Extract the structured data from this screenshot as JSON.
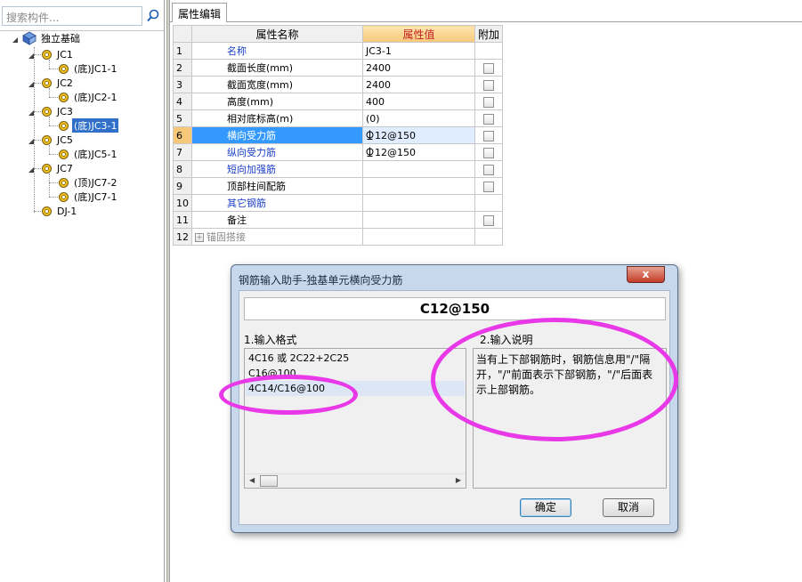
{
  "search": {
    "placeholder": "搜索构件..."
  },
  "tree": {
    "root": "独立基础",
    "nodes": [
      {
        "label": "JC1",
        "children": [
          "(底)JC1-1"
        ]
      },
      {
        "label": "JC2",
        "children": [
          "(底)JC2-1"
        ]
      },
      {
        "label": "JC3",
        "children": [
          "(底)JC3-1"
        ],
        "selected_child": "(底)JC3-1"
      },
      {
        "label": "JC5",
        "children": [
          "(底)JC5-1"
        ]
      },
      {
        "label": "JC7",
        "children": [
          "(顶)JC7-2",
          "(底)JC7-1"
        ]
      }
    ],
    "last": "DJ-1"
  },
  "tab": {
    "label": "属性编辑"
  },
  "grid": {
    "headers": {
      "name": "属性名称",
      "value": "属性值",
      "extra": "附加"
    },
    "rows": [
      {
        "n": "1",
        "name": "名称",
        "value": "JC3-1",
        "style": "blue",
        "check": false
      },
      {
        "n": "2",
        "name": "截面长度(mm)",
        "value": "2400",
        "style": "normal",
        "check": true
      },
      {
        "n": "3",
        "name": "截面宽度(mm)",
        "value": "2400",
        "style": "normal",
        "check": true
      },
      {
        "n": "4",
        "name": "高度(mm)",
        "value": "400",
        "style": "normal",
        "check": true
      },
      {
        "n": "5",
        "name": "相对底标高(m)",
        "value": "(0)",
        "style": "normal",
        "check": true
      },
      {
        "n": "6",
        "name": "横向受力筋",
        "value": " 12@150",
        "style": "selected",
        "check": true
      },
      {
        "n": "7",
        "name": "纵向受力筋",
        "value": " 12@150",
        "style": "blue",
        "check": true
      },
      {
        "n": "8",
        "name": "短向加强筋",
        "value": "",
        "style": "blue",
        "check": true
      },
      {
        "n": "9",
        "name": "顶部柱间配筋",
        "value": "",
        "style": "normal",
        "check": true
      },
      {
        "n": "10",
        "name": "其它钢筋",
        "value": "",
        "style": "blue",
        "check": false
      },
      {
        "n": "11",
        "name": "备注",
        "value": "",
        "style": "normal",
        "check": true
      },
      {
        "n": "12",
        "name": "锚固搭接",
        "value": "",
        "style": "gray",
        "check": false
      }
    ]
  },
  "dialog": {
    "title": "钢筋输入助手-独基单元横向受力筋",
    "close": "x",
    "input_value": "C12@150",
    "format_caption": "1.输入格式",
    "desc_caption": "2.输入说明",
    "formats": [
      "4C16 或 2C22+2C25",
      "C16@100",
      "4C14/C16@100"
    ],
    "description": "当有上下部钢筋时，钢筋信息用\"/\"隔开，\"/\"前面表示下部钢筋，\"/\"后面表示上部钢筋。",
    "ok": "确定",
    "cancel": "取消"
  },
  "colors": {
    "highlight_ring": "#e838e8",
    "selection": "#3399ff",
    "blue_text": "#1a3fc8"
  }
}
